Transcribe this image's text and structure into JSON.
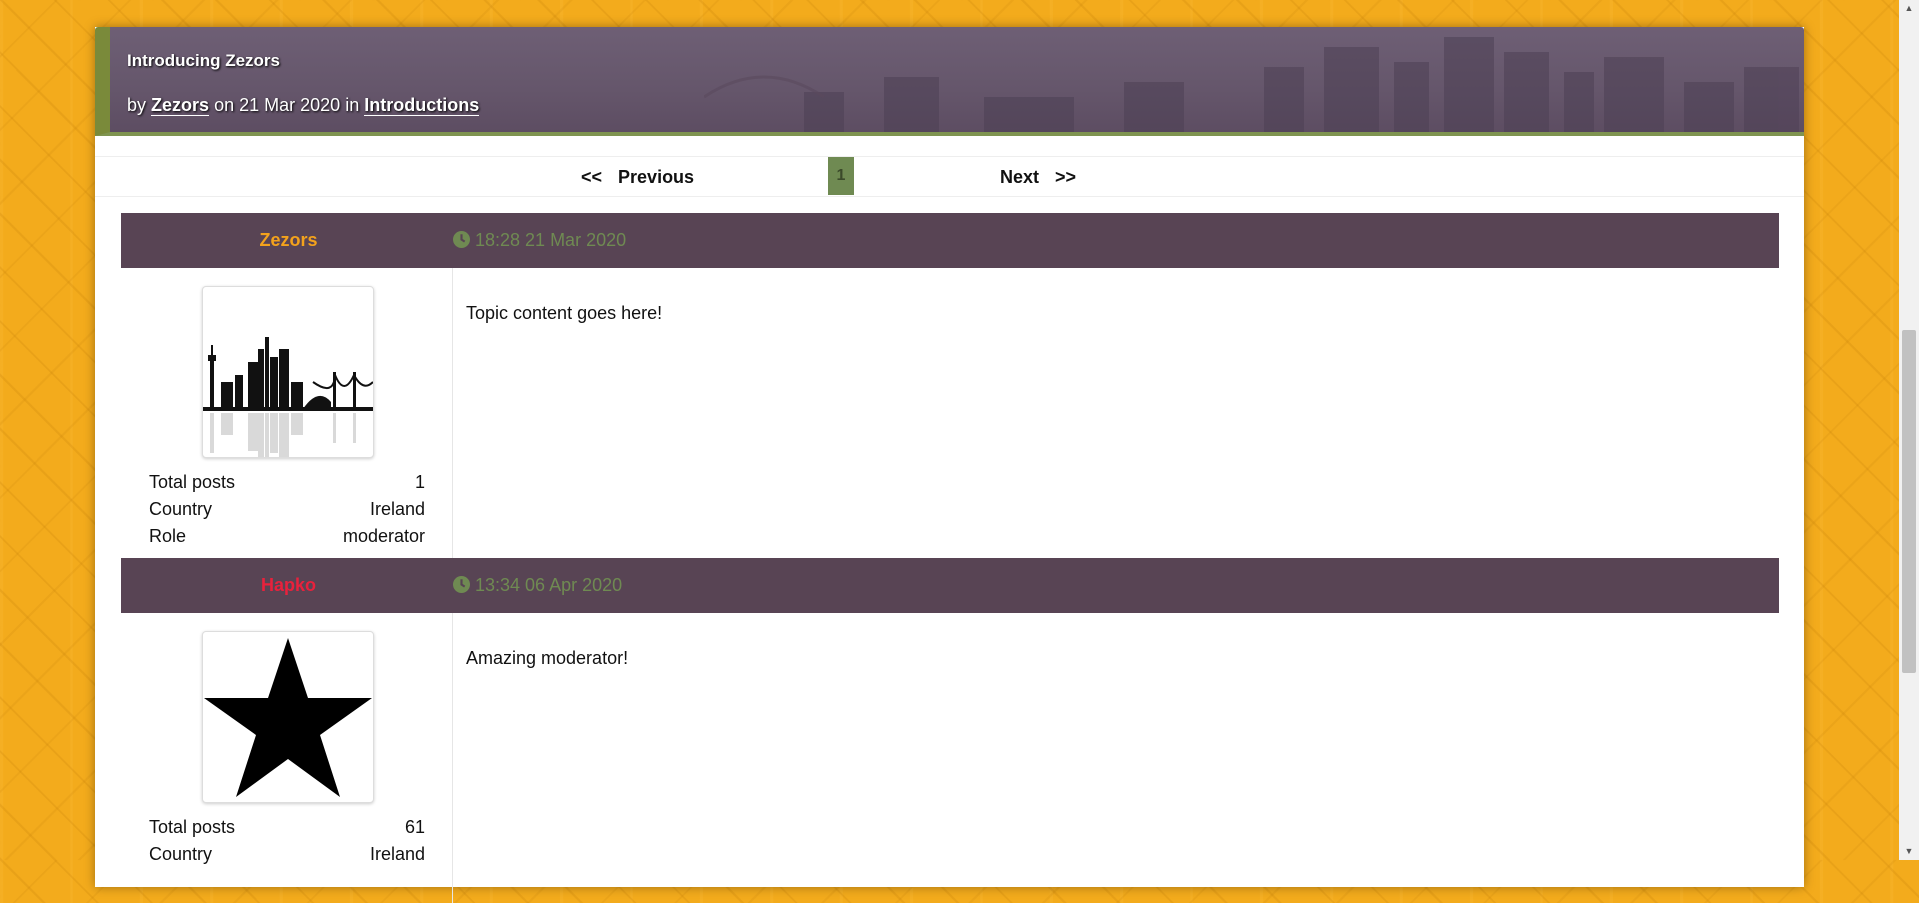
{
  "topic": {
    "title": "Introducing Zezors",
    "by_label": "by",
    "author": "Zezors",
    "on_label": "on",
    "date": "21 Mar 2020",
    "in_label": "in",
    "category": "Introductions"
  },
  "pager": {
    "prev_arrows": "<<",
    "prev_label": "Previous",
    "current_page": "1",
    "next_label": "Next",
    "next_arrows": ">>"
  },
  "posts": [
    {
      "author": "Zezors",
      "author_color": "#f3a21c",
      "time": "18:28 21 Mar 2020",
      "avatar_icon": "city-skyline-icon",
      "stats": [
        {
          "label": "Total posts",
          "value": "1"
        },
        {
          "label": "Country",
          "value": "Ireland"
        },
        {
          "label": "Role",
          "value": "moderator"
        }
      ],
      "content": "Topic content goes here!"
    },
    {
      "author": "Hapko",
      "author_color": "#e8213c",
      "time": "13:34 06 Apr 2020",
      "avatar_icon": "star-icon",
      "stats": [
        {
          "label": "Total posts",
          "value": "61"
        },
        {
          "label": "Country",
          "value": "Ireland"
        }
      ],
      "content": "Amazing moderator!"
    }
  ],
  "colors": {
    "background": "#f3ab1c",
    "header_bg": "#584454",
    "accent_green": "#6f8a52"
  }
}
